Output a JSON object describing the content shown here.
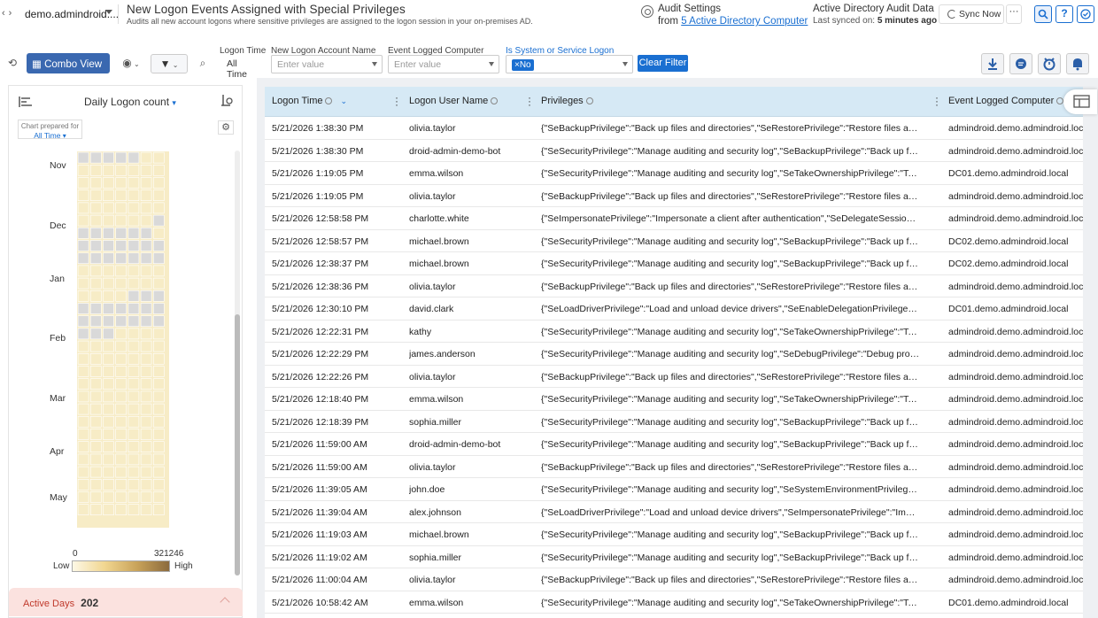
{
  "header": {
    "domain": "demo.admindroid....",
    "title": "New Logon Events Assigned with Special Privileges",
    "subtitle": "Audits all new account logons where sensitive privileges are assigned to the logon session in your on-premises AD.",
    "audit_settings": "Audit Settings",
    "audit_from": "from",
    "audit_link": "5 Active Directory Computer",
    "ad_title": "Active Directory Audit Data",
    "last_synced_label": "Last synced on:",
    "last_synced_value": "5 minutes ago",
    "sync_now": "Sync Now",
    "more": "···",
    "help": "?"
  },
  "toolbar": {
    "combo_view": "Combo View",
    "filters": [
      {
        "label": "Logon Time",
        "value": "All Time"
      },
      {
        "label": "New Logon Account Name",
        "placeholder": "Enter value"
      },
      {
        "label": "Event Logged Computer",
        "placeholder": "Enter value"
      },
      {
        "label": "Is System or Service Logon",
        "chip": "×No"
      }
    ],
    "clear_filter": "Clear Filter"
  },
  "chart": {
    "title": "Daily Logon count",
    "prepared_for_label": "Chart prepared for",
    "prepared_for_value": "All Time",
    "months": [
      "Nov",
      "Dec",
      "Jan",
      "Feb",
      "Mar",
      "Apr",
      "May"
    ],
    "legend_min": "0",
    "legend_max": "321246",
    "legend_low": "Low",
    "legend_high": "High",
    "colors": {
      "empty": "#d9d9d9",
      "low": "#f7ecc6"
    }
  },
  "active_days": {
    "label": "Active Days",
    "value": "202"
  },
  "table": {
    "columns": [
      "Logon Time",
      "Logon User Name",
      "Privileges",
      "Event Logged Computer"
    ],
    "rows": [
      [
        "5/21/2026 1:38:30 PM",
        "olivia.taylor",
        "{\"SeBackupPrivilege\":\"Back up files and directories\",\"SeRestorePrivilege\":\"Restore files and direct...",
        "admindroid.demo.admindroid.local"
      ],
      [
        "5/21/2026 1:38:30 PM",
        "droid-admin-demo-bot",
        "{\"SeSecurityPrivilege\":\"Manage auditing and security log\",\"SeBackupPrivilege\":\"Back up files and ...",
        "admindroid.demo.admindroid.local"
      ],
      [
        "5/21/2026 1:19:05 PM",
        "emma.wilson",
        "{\"SeSecurityPrivilege\":\"Manage auditing and security log\",\"SeTakeOwnershipPrivilege\":\"Take own...",
        "DC01.demo.admindroid.local"
      ],
      [
        "5/21/2026 1:19:05 PM",
        "olivia.taylor",
        "{\"SeBackupPrivilege\":\"Back up files and directories\",\"SeRestorePrivilege\":\"Restore files and direct...",
        "admindroid.demo.admindroid.local"
      ],
      [
        "5/21/2026 12:58:58 PM",
        "charlotte.white",
        "{\"SeImpersonatePrivilege\":\"Impersonate a client after authentication\",\"SeDelegateSessionUserIm...",
        "admindroid.demo.admindroid.local"
      ],
      [
        "5/21/2026 12:58:57 PM",
        "michael.brown",
        "{\"SeSecurityPrivilege\":\"Manage auditing and security log\",\"SeBackupPrivilege\":\"Back up files and ...",
        "DC02.demo.admindroid.local"
      ],
      [
        "5/21/2026 12:38:37 PM",
        "michael.brown",
        "{\"SeSecurityPrivilege\":\"Manage auditing and security log\",\"SeBackupPrivilege\":\"Back up files and ...",
        "DC02.demo.admindroid.local"
      ],
      [
        "5/21/2026 12:38:36 PM",
        "olivia.taylor",
        "{\"SeBackupPrivilege\":\"Back up files and directories\",\"SeRestorePrivilege\":\"Restore files and direct...",
        "admindroid.demo.admindroid.local"
      ],
      [
        "5/21/2026 12:30:10 PM",
        "david.clark",
        "{\"SeLoadDriverPrivilege\":\"Load and unload device drivers\",\"SeEnableDelegationPrivilege\":\"Enable ...",
        "DC01.demo.admindroid.local"
      ],
      [
        "5/21/2026 12:22:31 PM",
        "kathy",
        "{\"SeSecurityPrivilege\":\"Manage auditing and security log\",\"SeTakeOwnershipPrivilege\":\"Take own...",
        "admindroid.demo.admindroid.local"
      ],
      [
        "5/21/2026 12:22:29 PM",
        "james.anderson",
        "{\"SeSecurityPrivilege\":\"Manage auditing and security log\",\"SeDebugPrivilege\":\"Debug programs\",\"S...",
        "admindroid.demo.admindroid.local"
      ],
      [
        "5/21/2026 12:22:26 PM",
        "olivia.taylor",
        "{\"SeBackupPrivilege\":\"Back up files and directories\",\"SeRestorePrivilege\":\"Restore files and direct...",
        "admindroid.demo.admindroid.local"
      ],
      [
        "5/21/2026 12:18:40 PM",
        "emma.wilson",
        "{\"SeSecurityPrivilege\":\"Manage auditing and security log\",\"SeTakeOwnershipPrivilege\":\"Take own...",
        "admindroid.demo.admindroid.local"
      ],
      [
        "5/21/2026 12:18:39 PM",
        "sophia.miller",
        "{\"SeSecurityPrivilege\":\"Manage auditing and security log\",\"SeBackupPrivilege\":\"Back up files and ...",
        "admindroid.demo.admindroid.local"
      ],
      [
        "5/21/2026 11:59:00 AM",
        "droid-admin-demo-bot",
        "{\"SeSecurityPrivilege\":\"Manage auditing and security log\",\"SeBackupPrivilege\":\"Back up files and ...",
        "admindroid.demo.admindroid.local"
      ],
      [
        "5/21/2026 11:59:00 AM",
        "olivia.taylor",
        "{\"SeBackupPrivilege\":\"Back up files and directories\",\"SeRestorePrivilege\":\"Restore files and direct...",
        "admindroid.demo.admindroid.local"
      ],
      [
        "5/21/2026 11:39:05 AM",
        "john.doe",
        "{\"SeSecurityPrivilege\":\"Manage auditing and security log\",\"SeSystemEnvironmentPrivilege\":\"Modif...",
        "admindroid.demo.admindroid.local"
      ],
      [
        "5/21/2026 11:39:04 AM",
        "alex.johnson",
        "{\"SeLoadDriverPrivilege\":\"Load and unload device drivers\",\"SeImpersonatePrivilege\":\"Impersonate...",
        "admindroid.demo.admindroid.local"
      ],
      [
        "5/21/2026 11:19:03 AM",
        "michael.brown",
        "{\"SeSecurityPrivilege\":\"Manage auditing and security log\",\"SeBackupPrivilege\":\"Back up files and ...",
        "admindroid.demo.admindroid.local"
      ],
      [
        "5/21/2026 11:19:02 AM",
        "sophia.miller",
        "{\"SeSecurityPrivilege\":\"Manage auditing and security log\",\"SeBackupPrivilege\":\"Back up files and ...",
        "admindroid.demo.admindroid.local"
      ],
      [
        "5/21/2026 11:00:04 AM",
        "olivia.taylor",
        "{\"SeBackupPrivilege\":\"Back up files and directories\",\"SeRestorePrivilege\":\"Restore files and direct...",
        "admindroid.demo.admindroid.local"
      ],
      [
        "5/21/2026 10:58:42 AM",
        "emma.wilson",
        "{\"SeSecurityPrivilege\":\"Manage auditing and security log\",\"SeTakeOwnershipPrivilege\":\"Take own...",
        "DC01.demo.admindroid.local"
      ]
    ]
  }
}
